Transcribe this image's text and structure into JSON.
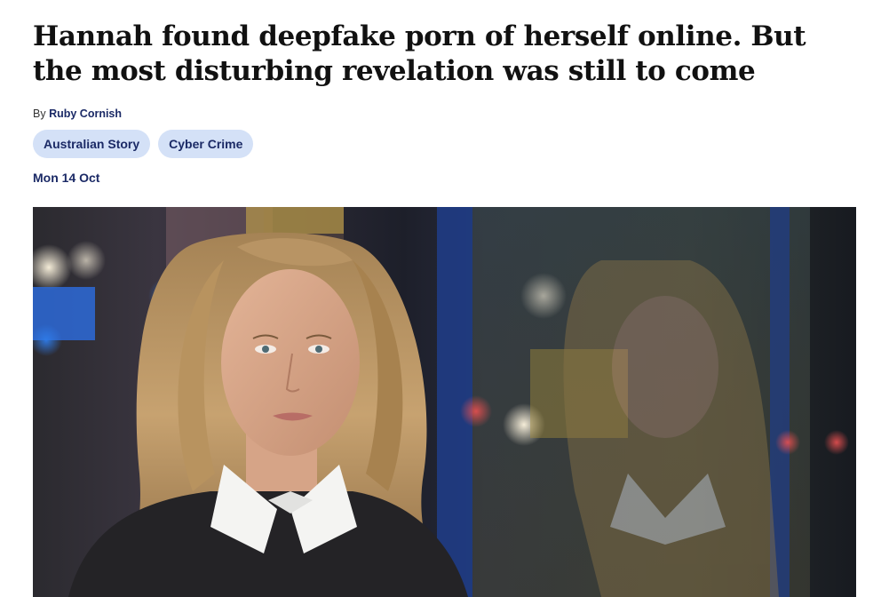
{
  "article": {
    "headline": "Hannah found deepfake porn of herself online. But the most disturbing revelation was still to come",
    "byline_prefix": "By",
    "author": "Ruby Cornish",
    "tags": [
      {
        "label": "Australian Story"
      },
      {
        "label": "Cyber Crime"
      }
    ],
    "date": "Mon 14 Oct"
  },
  "colors": {
    "link_navy": "#1b2a66",
    "tag_background": "#d4e1f7"
  }
}
